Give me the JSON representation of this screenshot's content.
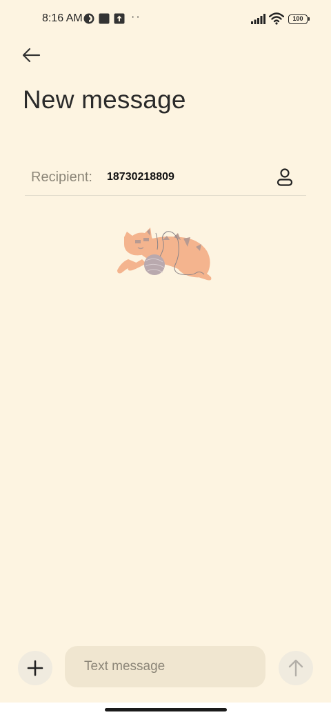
{
  "status_bar": {
    "time": "8:16 AM",
    "battery": "100",
    "icons": [
      "app-notification-icon",
      "square-notification-icon",
      "upload-notification-icon",
      "more-dots-icon",
      "signal-icon",
      "wifi-icon",
      "battery-icon"
    ]
  },
  "header": {
    "back_icon": "arrow-left-icon",
    "title": "New message"
  },
  "recipient": {
    "label": "Recipient:",
    "value": "18730218809",
    "contact_icon": "person-icon"
  },
  "illustration": {
    "name": "cat-with-yarn-ball",
    "colors": {
      "cat": "#f4b48e",
      "stripes": "#b79a91",
      "yarn": "#b9a9ae"
    }
  },
  "composer": {
    "placeholder": "Text message",
    "value": "",
    "attach_icon": "plus-icon",
    "send_icon": "arrow-up-icon"
  },
  "colors": {
    "background": "#fdf4e1",
    "input_background": "#f0e6d0",
    "button_background": "#f0ebdf",
    "disabled_icon": "#b3afa8"
  }
}
